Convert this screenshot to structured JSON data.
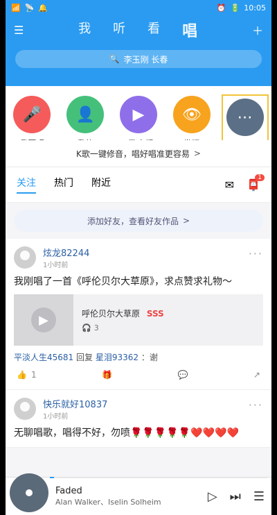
{
  "status": {
    "time": "10:05",
    "icons": [
      "signal-icon",
      "wifi-icon",
      "bell-icon",
      "alarm-icon",
      "battery-icon"
    ]
  },
  "nav": {
    "menu_icon": "menu-icon",
    "tabs": [
      "我",
      "听",
      "看",
      "唱"
    ],
    "active_tab": "唱",
    "add_icon": "plus-icon"
  },
  "search": {
    "placeholder": "李玉刚 长春",
    "icon": "search-icon"
  },
  "quick_actions": [
    {
      "label": "我要唱",
      "color": "#f55b5b",
      "icon": "mic-icon"
    },
    {
      "label": "我的",
      "color": "#45c07b",
      "icon": "user-icon"
    },
    {
      "label": "K歌直播",
      "color": "#8f6fe9",
      "icon": "live-icon"
    },
    {
      "label": "发现",
      "color": "#f7a31e",
      "icon": "eye-icon"
    },
    {
      "label": "全部",
      "color": "#5b6f86",
      "icon": "grid-icon"
    }
  ],
  "tip": {
    "text": "K歌一键修音，唱好唱准更容易",
    "chevron": ">"
  },
  "filter_tabs": {
    "tabs": [
      "关注",
      "热门",
      "附近"
    ],
    "active": "关注",
    "mail_icon": "mail-icon",
    "gift_icon": "gift-box-icon",
    "badge": "1"
  },
  "add_friends": {
    "text": "添加好友，查看好友作品",
    "chevron": ">"
  },
  "posts": [
    {
      "user": "炫龙82244",
      "time": "1小时前",
      "text": "我刚唱了一首《呼伦贝尔大草原》，求点赞求礼物～",
      "song": {
        "title": "呼伦贝尔大草原",
        "tag": "SSS",
        "plays": "3"
      },
      "comment": {
        "from": "平淡人生45681",
        "reply": "回复",
        "to": "星泪93362",
        "suffix": "：谢"
      },
      "actions": {
        "likes": "1"
      }
    },
    {
      "user": "快乐就好10837",
      "time": "1小时前",
      "text": "无聊唱歌，唱得不好，勿喷🌹🌹🌹🌹🌹❤️❤️❤️❤️"
    }
  ],
  "now_playing": {
    "title": "Faded",
    "artist": "Alan Walker、Iselin Solheim",
    "progress": 0.02
  },
  "colors": {
    "brand": "#2a9bf1"
  }
}
